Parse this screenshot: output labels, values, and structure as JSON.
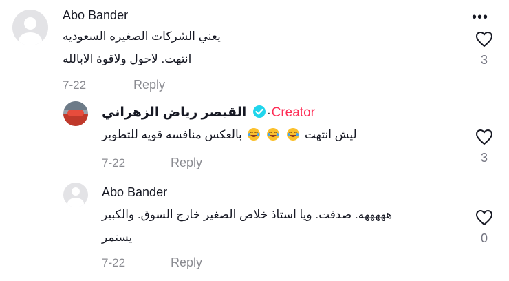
{
  "comments": [
    {
      "username": "Abo Bander",
      "text_line1": "يعني الشركات الصغيره السعوديه",
      "text_line2": "انتهت. لاحول ولاقوة الابالله",
      "date": "7-22",
      "reply_label": "Reply",
      "likes": "3"
    },
    {
      "username": "القيصر رياض الزهراني",
      "creator_label": "Creator",
      "text_before": "ليش انتهت",
      "text_after": "بالعكس منافسه قويه للتطوير",
      "emojis": [
        "joy-emoji",
        "joy-emoji",
        "joy-emoji"
      ],
      "date": "7-22",
      "reply_label": "Reply",
      "likes": "3"
    },
    {
      "username": "Abo Bander",
      "text_line1": "هههههه. صدقت. ويا استاذ خلاص الصغير خارج السوق. والكبير",
      "text_line2": "يستمر",
      "date": "7-22",
      "reply_label": "Reply",
      "likes": "0"
    }
  ],
  "more_icon": "more-horizontal-icon",
  "like_icon": "heart-outline-icon",
  "colors": {
    "creator": "#fe2c55",
    "verified": "#20d5ec",
    "secondary": "#8a8b91"
  }
}
